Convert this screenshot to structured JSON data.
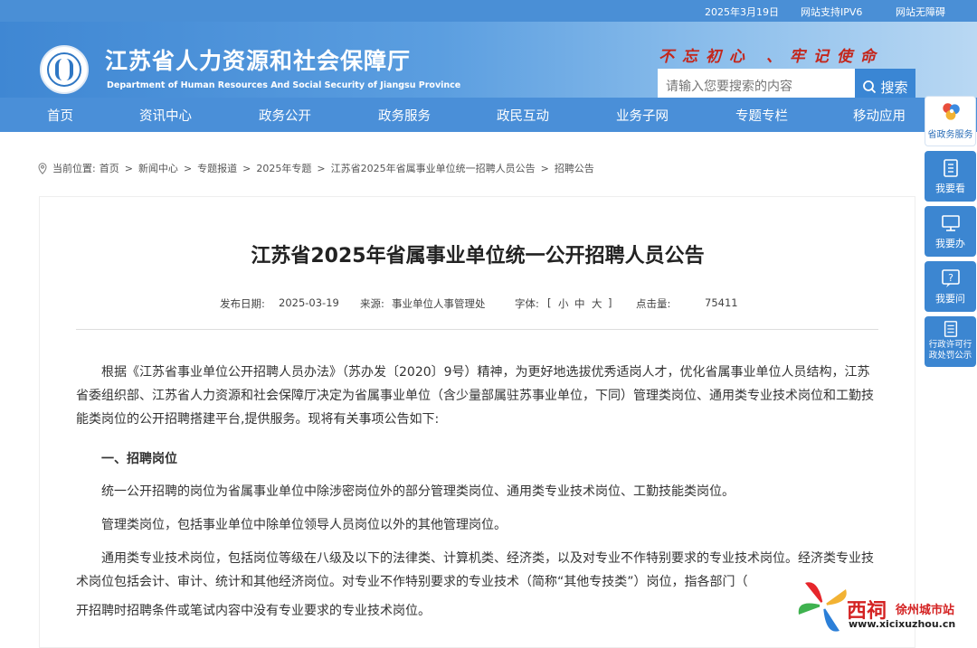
{
  "topbar": {
    "date": "2025年3月19日",
    "ipv6": "网站支持IPV6",
    "accessible": "网站无障碍"
  },
  "header": {
    "title": "江苏省人力资源和社会保障厅",
    "subtitle": "Department of Human Resources And Social Security of Jiangsu Province",
    "slogan": "不忘初心 、牢记使命",
    "search_placeholder": "请输入您要搜索的内容",
    "search_button": "搜索"
  },
  "nav": [
    "首页",
    "资讯中心",
    "政务公开",
    "政务服务",
    "政民互动",
    "业务子网",
    "专题专栏",
    "移动应用"
  ],
  "breadcrumb": {
    "prefix": "当前位置:",
    "items": [
      "首页",
      "新闻中心",
      "专题报道",
      "2025年专题",
      "江苏省2025年省属事业单位统一招聘人员公告",
      "招聘公告"
    ],
    "separator": ">"
  },
  "article": {
    "title": "江苏省2025年省属事业单位统一公开招聘人员公告",
    "meta": {
      "date_label": "发布日期:",
      "date": "2025-03-19",
      "source_label": "来源:",
      "source": "事业单位人事管理处",
      "font_label": "字体:",
      "font_open": "[",
      "font_small": "小",
      "font_mid": "中",
      "font_large": "大",
      "font_close": "]",
      "hits_label": "点击量:",
      "hits": "75411"
    },
    "p1": "根据《江苏省事业单位公开招聘人员办法》（苏办发〔2020〕9号）精神，为更好地选拔优秀适岗人才，优化省属事业单位人员结构，江苏省委组织部、江苏省人力资源和社会保障厅决定为省属事业单位（含少量部属驻苏事业单位，下同）管理类岗位、通用类专业技术岗位和工勤技能类岗位的公开招聘搭建平台,提供服务。现将有关事项公告如下:",
    "section1": "一、招聘岗位",
    "p2": "统一公开招聘的岗位为省属事业单位中除涉密岗位外的部分管理类岗位、通用类专业技术岗位、工勤技能类岗位。",
    "p3": "管理类岗位，包括事业单位中除单位领导人员岗位以外的其他管理岗位。",
    "p4": "通用类专业技术岗位，包括岗位等级在八级及以下的法律类、计算机类、经济类，以及对专业不作特别要求的专业技术岗位。经济类专业技术岗位包括会计、审计、统计和其他经济岗位。对专业不作特别要求的专业技术（简称“其他专技类”）岗位，指各部门（",
    "p4_end": "开招聘时招聘条件或笔试内容中没有专业要求的专业技术岗位。"
  },
  "side_tools": [
    "省政务服务",
    "我要看",
    "我要办",
    "我要问",
    "行政许可行政处罚公示"
  ],
  "watermark": {
    "brand": "西祠",
    "city": "徐州城市站",
    "url": "www.xicixuzhou.cn"
  },
  "colors": {
    "header_blue": "#4a8fd8",
    "slogan_red": "#c4261b",
    "side_blue": "#3c86d1"
  }
}
